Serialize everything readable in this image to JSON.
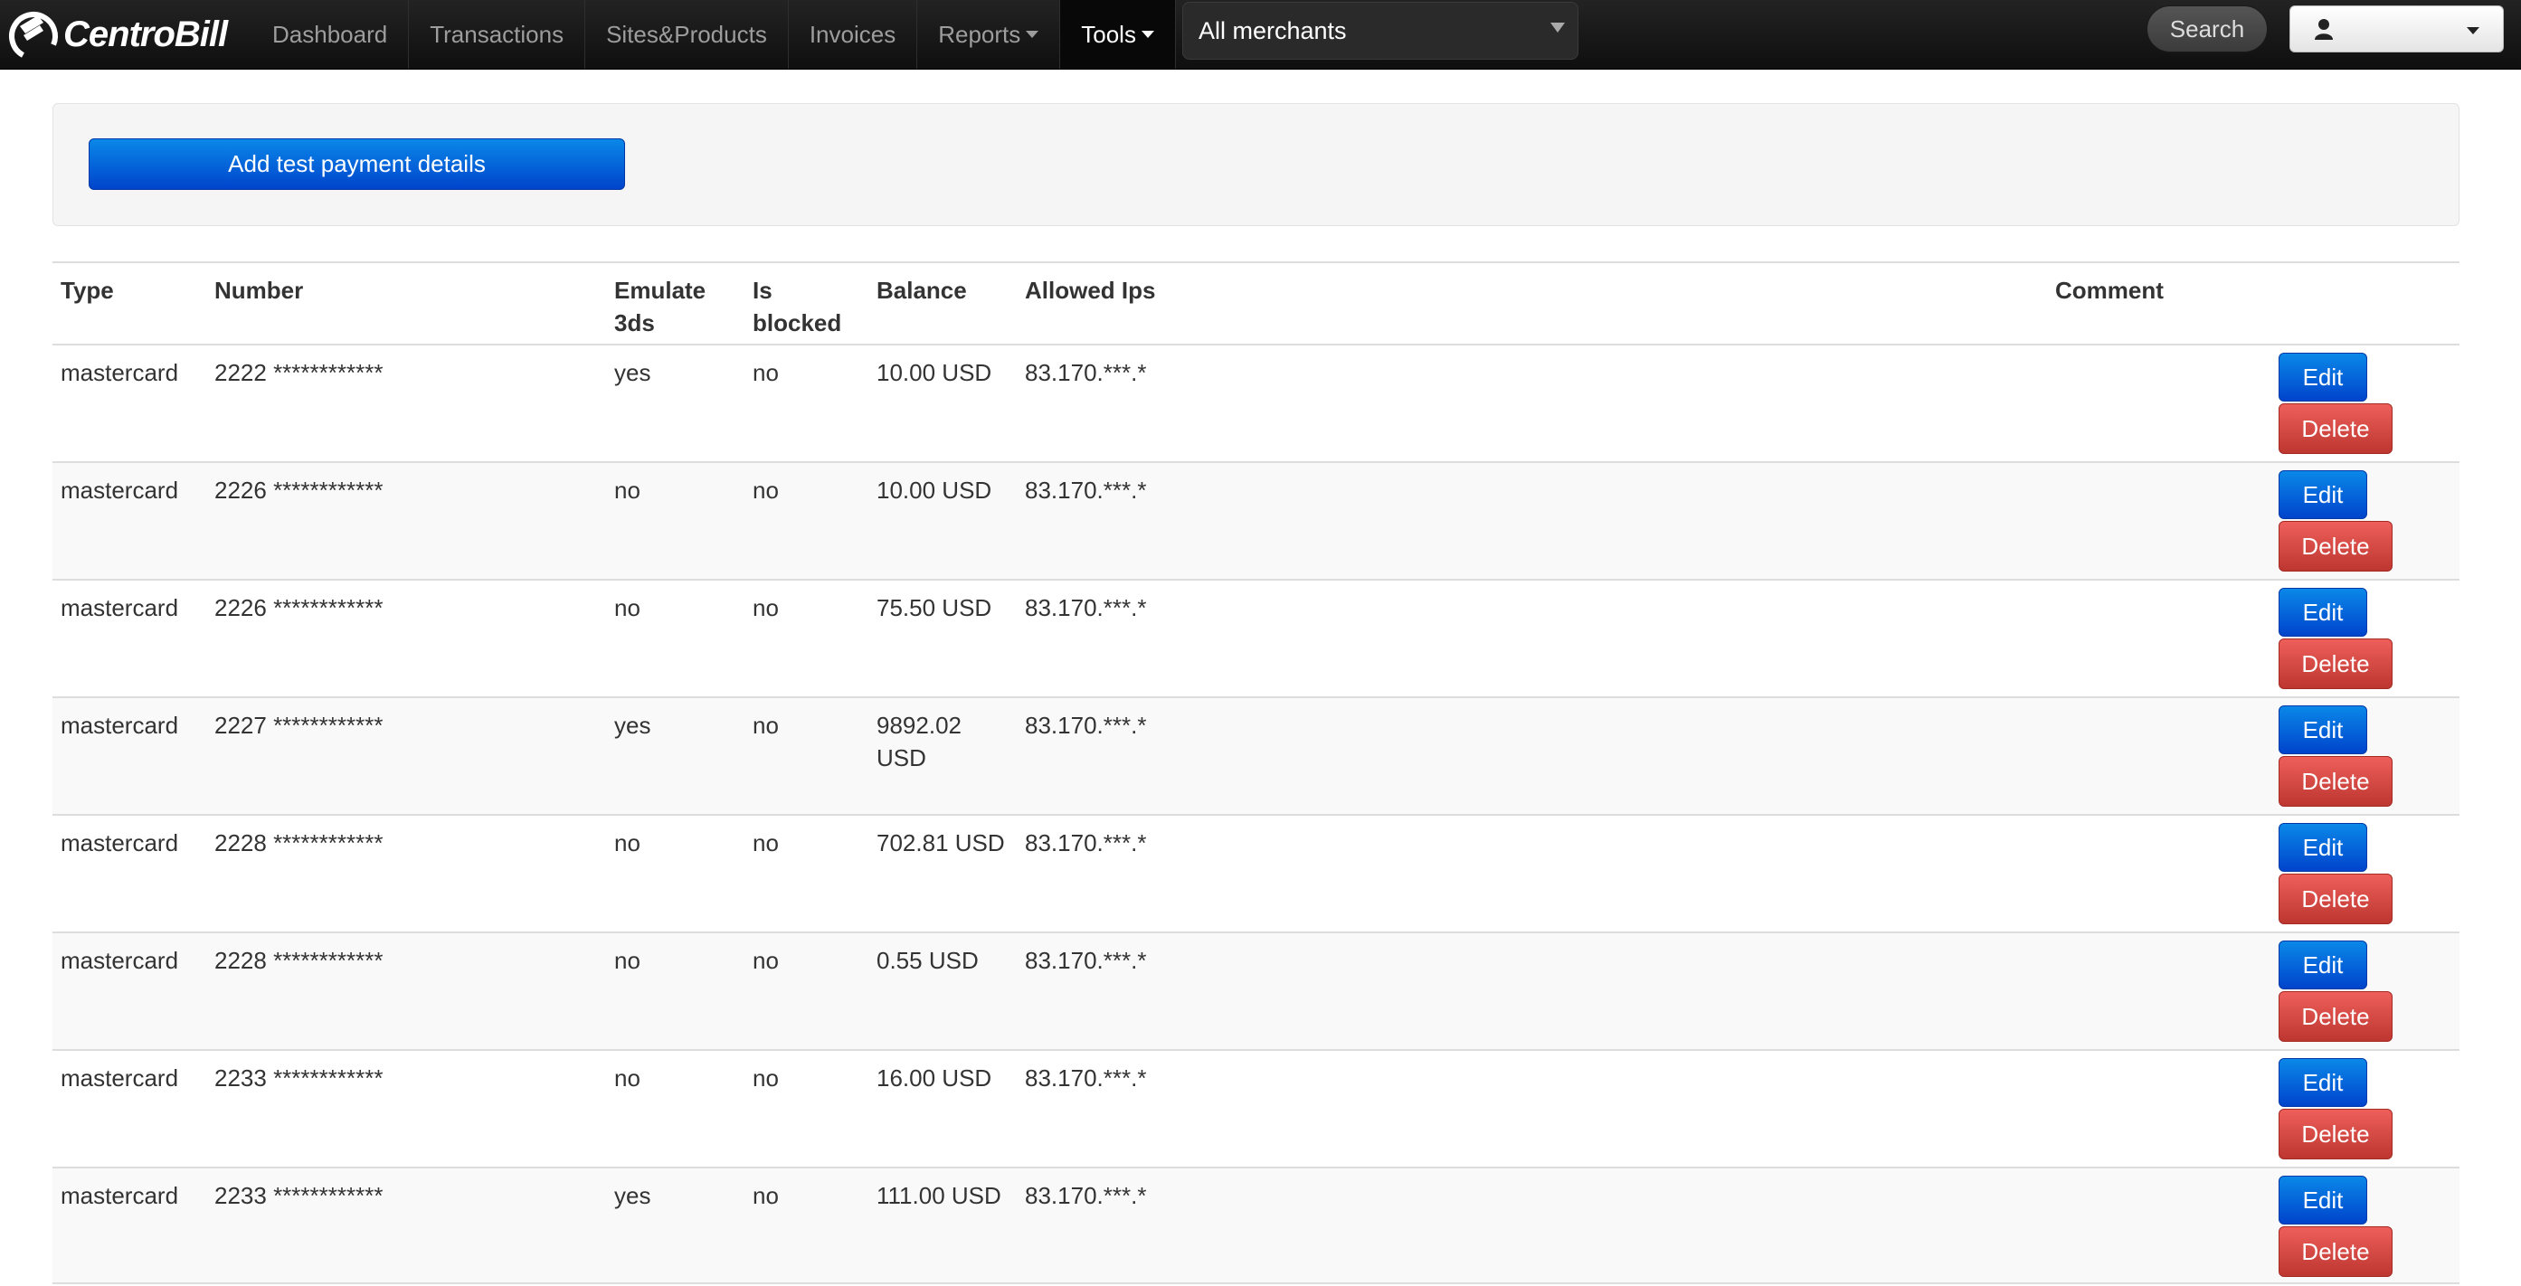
{
  "brand": {
    "name": "CentroBill"
  },
  "nav": {
    "items": [
      {
        "label": "Dashboard"
      },
      {
        "label": "Transactions"
      },
      {
        "label": "Sites&Products"
      },
      {
        "label": "Invoices"
      },
      {
        "label": "Reports"
      },
      {
        "label": "Tools"
      }
    ],
    "active": "Tools"
  },
  "merchant_select": {
    "value": "All merchants"
  },
  "search": {
    "label": "Search"
  },
  "user_menu": {
    "icon": "user-icon"
  },
  "actions": {
    "add_label": "Add test payment details"
  },
  "table": {
    "headers": {
      "type": "Type",
      "number": "Number",
      "emulate": "Emulate 3ds",
      "blocked": "Is blocked",
      "balance": "Balance",
      "ips": "Allowed Ips",
      "comment": "Comment"
    },
    "edit_label": "Edit",
    "delete_label": "Delete",
    "rows": [
      {
        "type": "mastercard",
        "number": "2222 ************",
        "emulate": "yes",
        "blocked": "no",
        "balance": "10.00 USD",
        "ips": "83.170.***.*",
        "comment": ""
      },
      {
        "type": "mastercard",
        "number": "2226 ************",
        "emulate": "no",
        "blocked": "no",
        "balance": "10.00 USD",
        "ips": "83.170.***.*",
        "comment": ""
      },
      {
        "type": "mastercard",
        "number": "2226 ************",
        "emulate": "no",
        "blocked": "no",
        "balance": "75.50 USD",
        "ips": "83.170.***.*",
        "comment": ""
      },
      {
        "type": "mastercard",
        "number": "2227 ************",
        "emulate": "yes",
        "blocked": "no",
        "balance": "9892.02 USD",
        "ips": "83.170.***.*",
        "comment": ""
      },
      {
        "type": "mastercard",
        "number": "2228 ************",
        "emulate": "no",
        "blocked": "no",
        "balance": "702.81 USD",
        "ips": "83.170.***.*",
        "comment": ""
      },
      {
        "type": "mastercard",
        "number": "2228 ************",
        "emulate": "no",
        "blocked": "no",
        "balance": "0.55 USD",
        "ips": "83.170.***.*",
        "comment": ""
      },
      {
        "type": "mastercard",
        "number": "2233 ************",
        "emulate": "no",
        "blocked": "no",
        "balance": "16.00 USD",
        "ips": "83.170.***.*",
        "comment": ""
      },
      {
        "type": "mastercard",
        "number": "2233 ************",
        "emulate": "yes",
        "blocked": "no",
        "balance": "111.00 USD",
        "ips": "83.170.***.*",
        "comment": ""
      }
    ]
  },
  "colors": {
    "navbar": "#111111",
    "primary": "#0055d4",
    "danger": "#c9302c",
    "stripe": "#f9f9f9"
  }
}
